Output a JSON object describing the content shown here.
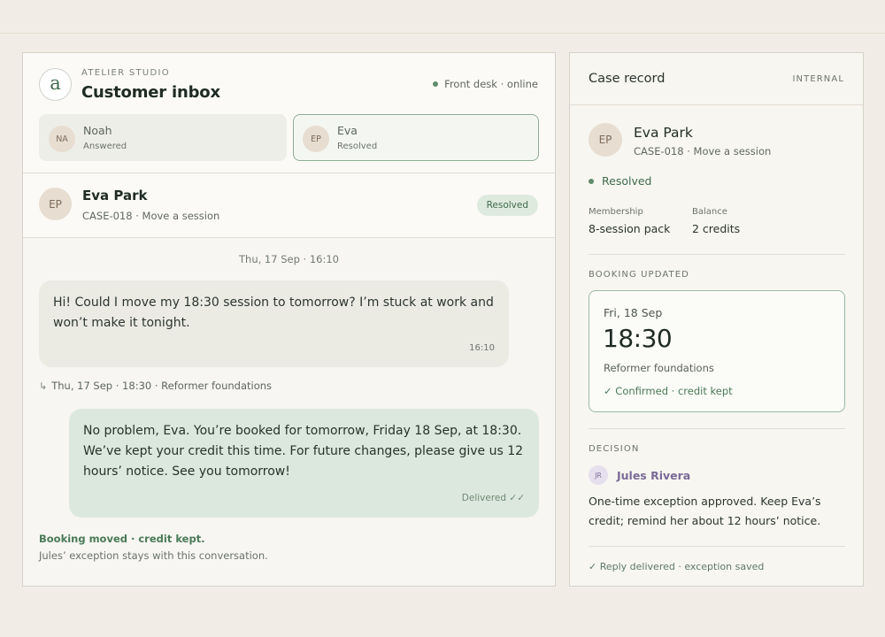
{
  "inbox": {
    "studio": "ATELIER STUDIO",
    "logo_letter": "a",
    "title": "Customer inbox",
    "status": "Front desk · online",
    "conversations": [
      {
        "initials": "NA",
        "name": "Noah",
        "status": "Answered"
      },
      {
        "initials": "EP",
        "name": "Eva",
        "status": "Resolved"
      }
    ],
    "contact": {
      "initials": "EP",
      "name": "Eva Park",
      "case": "CASE-018 · Move a session",
      "badge": "Resolved"
    },
    "thread": {
      "day": "Thu, 17 Sep · 16:10",
      "incoming": {
        "text": "Hi! Could I move my 18:30 session to tomorrow? I’m stuck at work and won’t make it tonight.",
        "time": "16:10"
      },
      "reference": "Thu, 17 Sep · 18:30 · Reformer foundations",
      "outgoing": {
        "text": "No problem, Eva. You’re booked for tomorrow, Friday 18 Sep, at 18:30. We’ve kept your credit this time. For future changes, please give us 12 hours’ notice. See you tomorrow!",
        "status": "Delivered ✓✓"
      },
      "note_strong": "Booking moved · credit kept.",
      "note_sub": "Jules’ exception stays with this conversation."
    }
  },
  "record": {
    "title": "Case record",
    "tag": "INTERNAL",
    "initials": "EP",
    "name": "Eva Park",
    "case": "CASE-018 · Move a session",
    "status": "Resolved",
    "membership_label": "Membership",
    "membership_value": "8-session pack",
    "balance_label": "Balance",
    "balance_value": "2 credits",
    "booking_label": "BOOKING UPDATED",
    "booking": {
      "date": "Fri, 18 Sep",
      "time": "18:30",
      "class": "Reformer foundations",
      "confirm": "✓ Confirmed · credit kept"
    },
    "decision_label": "DECISION",
    "decider_initials": "JR",
    "decider_name": "Jules Rivera",
    "decision_text": "One-time exception approved. Keep Eva’s credit; remind her about 12 hours’ notice.",
    "footer": "✓ Reply delivered · exception saved"
  },
  "colors": {
    "accent": "#3f6b4c",
    "background": "#f1ede6",
    "outgoing_bubble": "#dce8dd"
  }
}
